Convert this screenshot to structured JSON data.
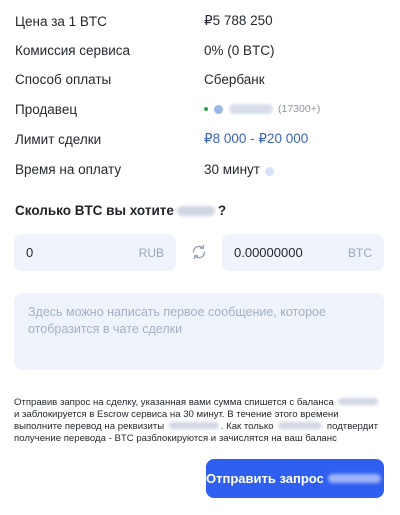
{
  "details": {
    "price": {
      "label": "Цена за 1 BTC",
      "value": "₽5 788 250"
    },
    "fee": {
      "label": "Комиссия сервиса",
      "value": "0% (0 BTC)"
    },
    "payment_method": {
      "label": "Способ оплаты",
      "value": "Сбербанк"
    },
    "seller": {
      "label": "Продавец",
      "stats": "(17300+)"
    },
    "limit": {
      "label": "Лимит сделки",
      "value": "₽8 000 - ₽20 000"
    },
    "pay_time": {
      "label": "Время на оплату",
      "value": "30 минут"
    }
  },
  "question": {
    "text": "Сколько BTC вы хотите",
    "suffix": "?"
  },
  "amount": {
    "rub": {
      "value": "0",
      "currency": "RUB"
    },
    "btc": {
      "value": "0.00000000",
      "currency": "BTC"
    }
  },
  "message": {
    "placeholder": "Здесь можно написать первое сообщение, которое отобразится в чате сделки"
  },
  "notice": {
    "part1": "Отправив запрос на сделку, указанная вами сумма спишется с баланса",
    "part2": "и заблокируется в Escrow сервиса на 30 минут. В течение этого времени выполните перевод на реквизиты",
    "part3": ". Как только",
    "part4": "подтвердит получение перевода - BTC разблокируются и зачислятся на ваш баланс"
  },
  "submit": {
    "label": "Отправить запрос"
  },
  "colors": {
    "accent": "#2f5ff0",
    "link": "#3a62b5",
    "field_bg": "#eef3fc"
  }
}
